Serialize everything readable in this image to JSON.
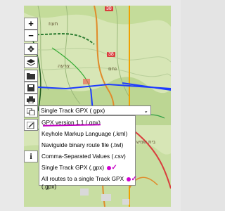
{
  "map": {
    "road_badges": [
      "38",
      "38"
    ],
    "place_labels": [
      "תעוז",
      "צרעה",
      "נחם",
      "בית שמש"
    ]
  },
  "toolbar": {
    "buttons": [
      {
        "name": "zoom-in-button",
        "icon": "plus",
        "glyph": "+"
      },
      {
        "name": "zoom-out-button",
        "icon": "minus",
        "glyph": "−"
      },
      {
        "name": "locate-button",
        "icon": "crosshair",
        "glyph": "✥"
      },
      {
        "name": "layers-button",
        "icon": "layers",
        "glyph": "≋"
      },
      {
        "name": "open-folder-button",
        "icon": "folder",
        "glyph": "📂"
      },
      {
        "name": "save-button",
        "icon": "floppy",
        "glyph": "💾"
      },
      {
        "name": "print-button",
        "icon": "printer",
        "glyph": "⎙"
      },
      {
        "name": "export-button",
        "icon": "export",
        "glyph": "⧉"
      },
      {
        "name": "edit-button",
        "icon": "pencil",
        "glyph": "✎"
      },
      {
        "name": "info-button",
        "icon": "info",
        "glyph": "i"
      }
    ]
  },
  "export_format": {
    "selected": "Single Track GPX ( gpx)",
    "options": [
      "GPX version 1.1 (.gpx)",
      "Keyhole Markup Language (.kml)",
      "Naviguide binary route file (.twl)",
      "Comma-Separated Values (.csv)",
      "Single Track GPX (.gpx)",
      "All routes to a single Track GPX",
      "(.gpx)"
    ],
    "annotation_color": "#d100d1"
  }
}
